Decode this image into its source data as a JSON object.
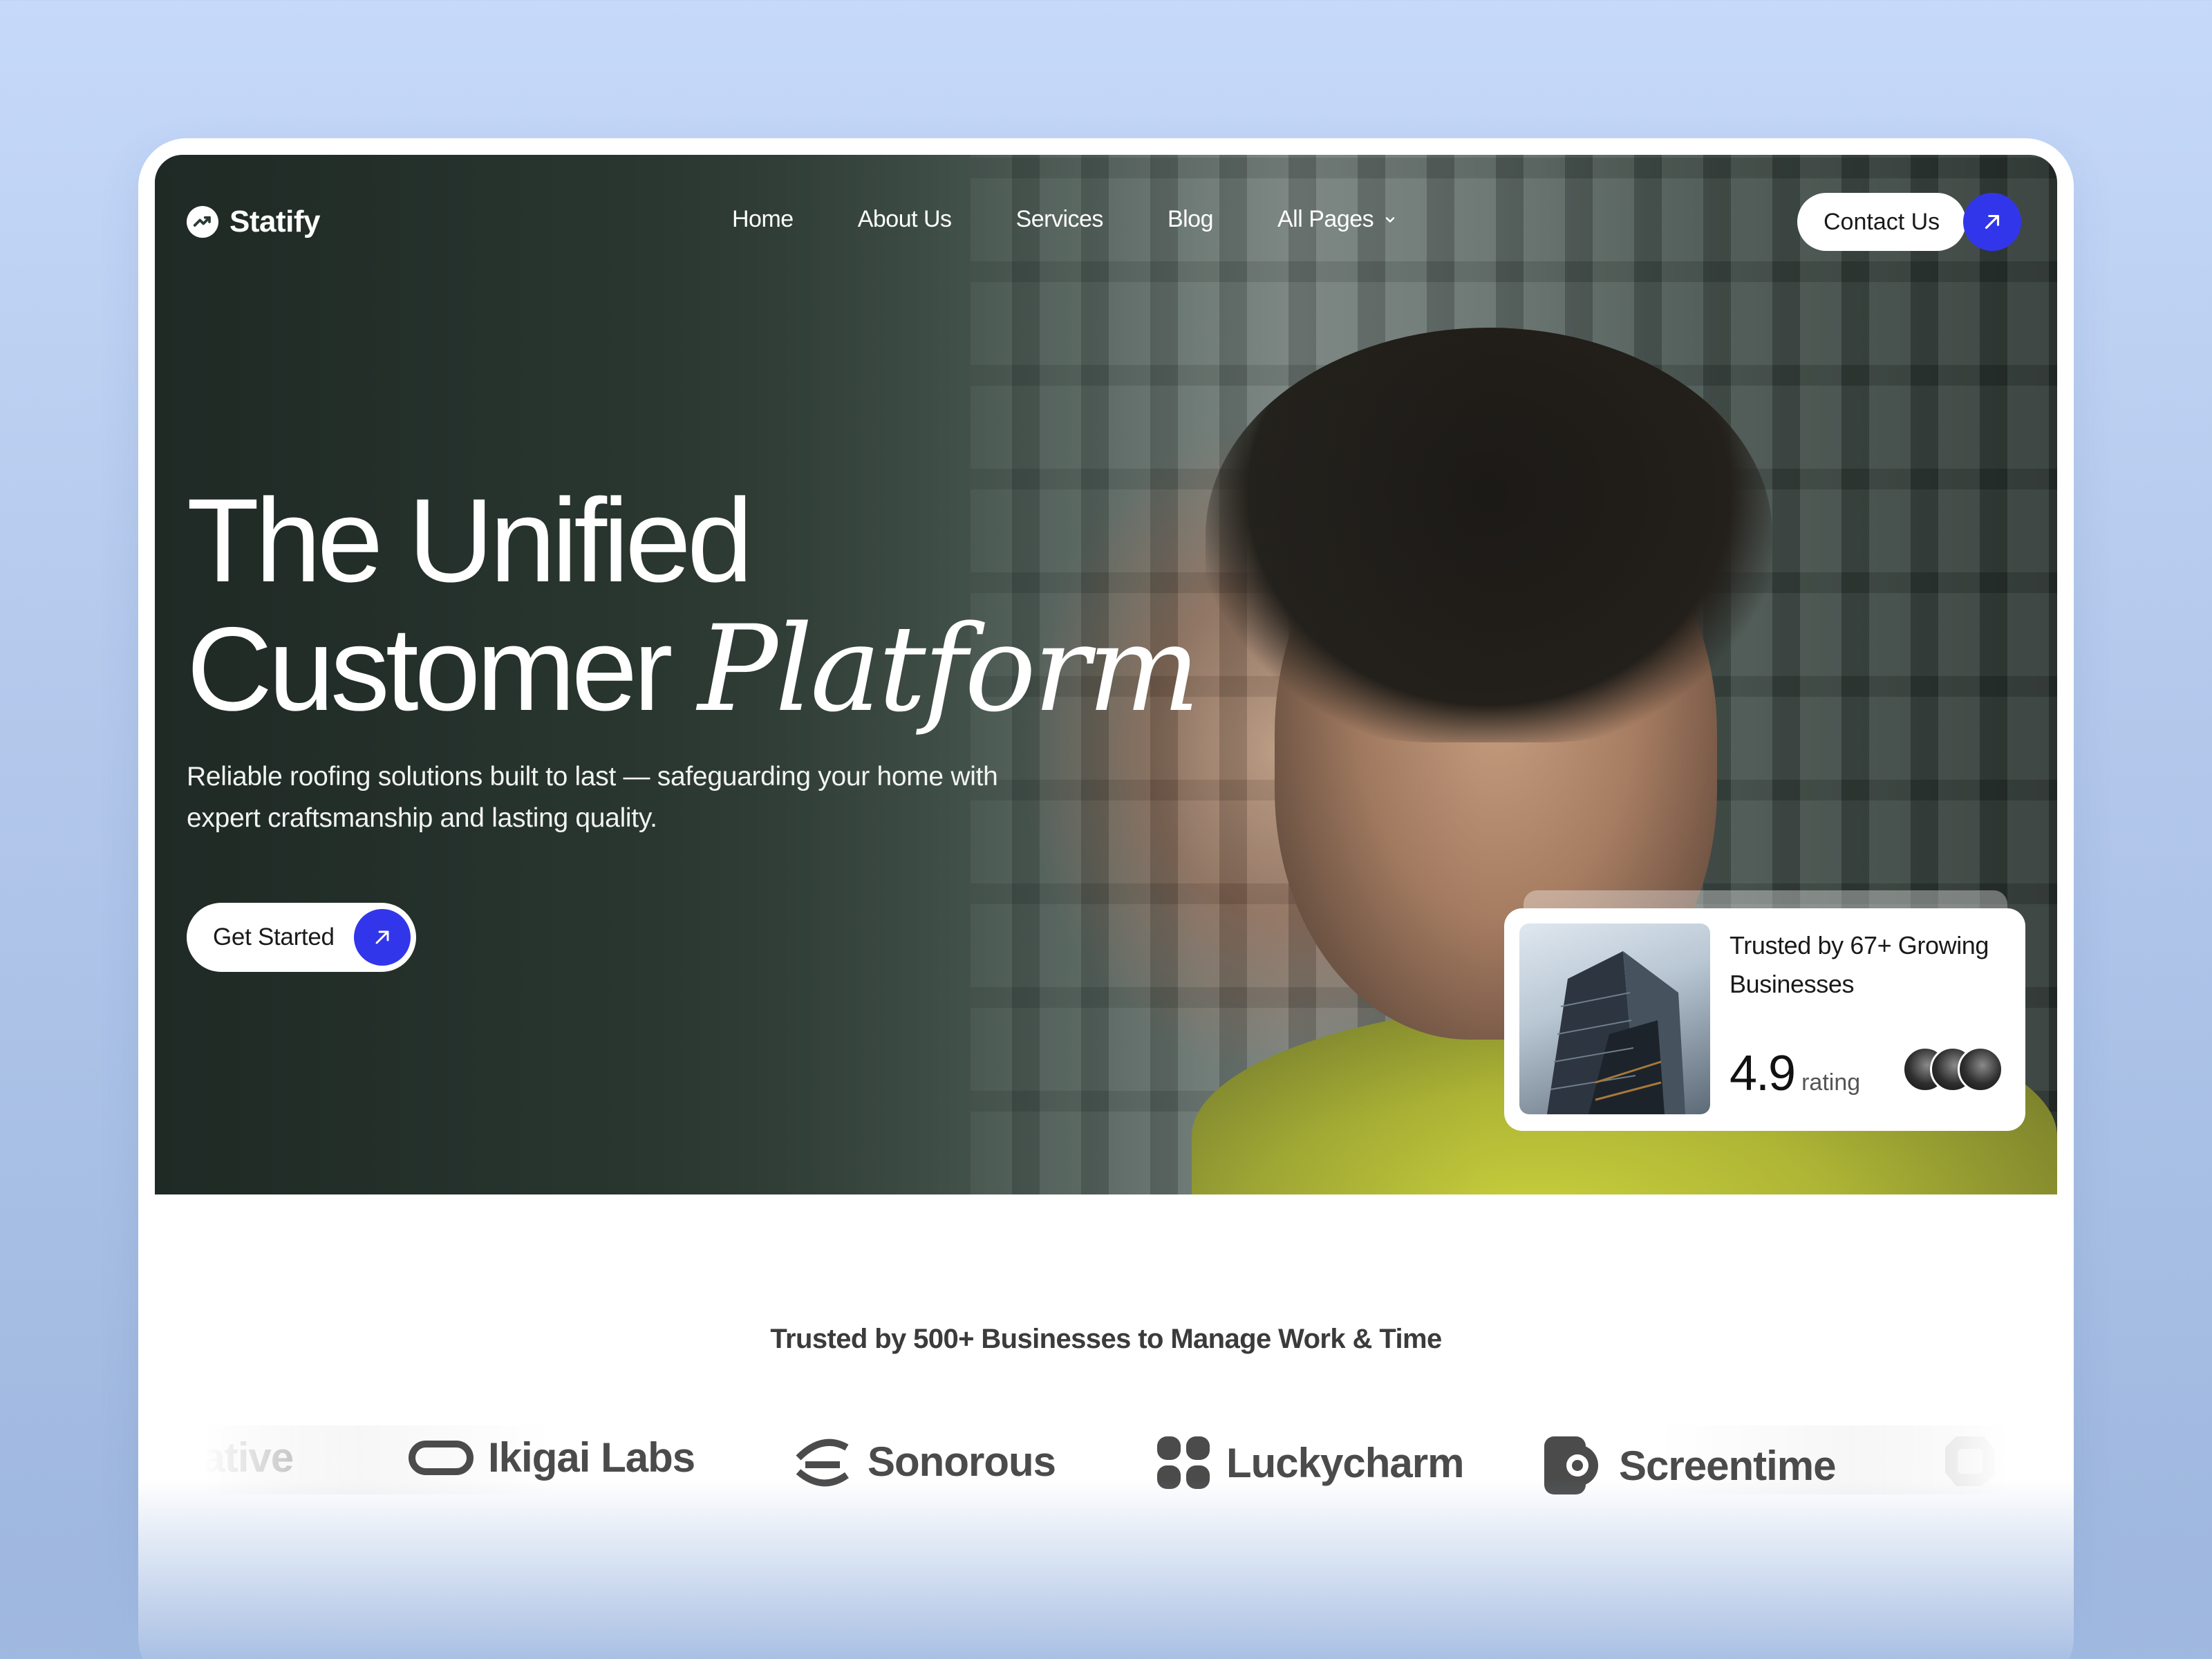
{
  "brand": {
    "name": "Statify",
    "icon": "trend-up-icon"
  },
  "nav": {
    "links": [
      "Home",
      "About Us",
      "Services",
      "Blog",
      "All Pages"
    ],
    "contact_label": "Contact Us"
  },
  "hero": {
    "headline_line1": "The Unified",
    "headline_line2_plain": "Customer",
    "headline_line2_italic": "Platform",
    "subtitle": "Reliable roofing solutions built to last — safeguarding your home with expert craftsmanship and lasting quality.",
    "cta_label": "Get Started"
  },
  "trust_card": {
    "title": "Trusted by 67+ Growing Businesses",
    "rating_value": "4.9",
    "rating_label": "rating"
  },
  "trusted_section": {
    "title": "Trusted by 500+ Businesses to Manage Work & Time",
    "brands": [
      "rative",
      "Ikigai Labs",
      "Sonorous",
      "Luckycharm",
      "Screentime"
    ]
  },
  "colors": {
    "accent": "#3236ea",
    "background": "#c6d9fa",
    "card": "#ffffff",
    "text_dark": "#1a1a1a"
  }
}
